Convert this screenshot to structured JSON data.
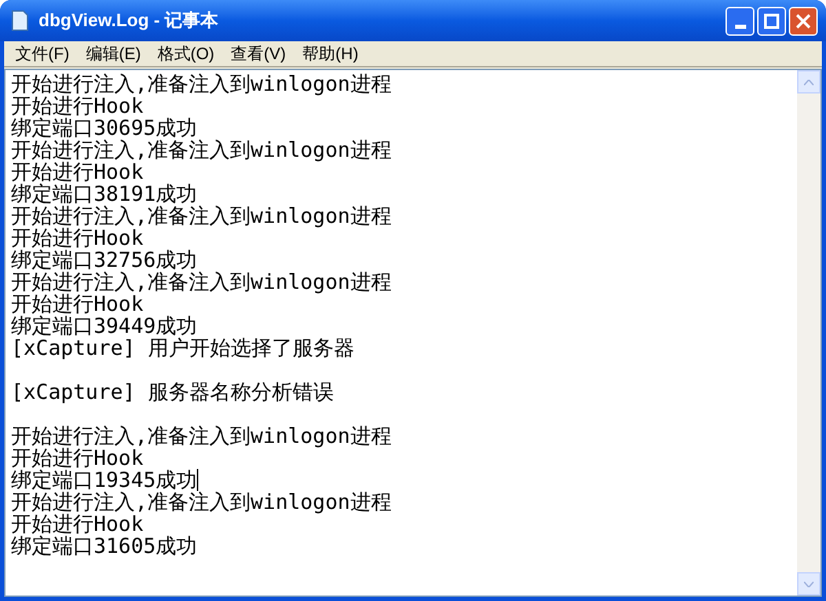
{
  "window": {
    "title": "dbgView.Log - 记事本"
  },
  "menu": [
    "文件(F)",
    "编辑(E)",
    "格式(O)",
    "查看(V)",
    "帮助(H)"
  ],
  "paragraphs": [
    {
      "lines": [
        {
          "text": "开始进行注入,准备注入到winlogon进程",
          "caret": false
        },
        {
          "text": "开始进行Hook",
          "caret": false
        },
        {
          "text": "绑定端口30695成功",
          "caret": false
        },
        {
          "text": "开始进行注入,准备注入到winlogon进程",
          "caret": false
        },
        {
          "text": "开始进行Hook",
          "caret": false
        },
        {
          "text": "绑定端口38191成功",
          "caret": false
        },
        {
          "text": "开始进行注入,准备注入到winlogon进程",
          "caret": false
        },
        {
          "text": "开始进行Hook",
          "caret": false
        },
        {
          "text": "绑定端口32756成功",
          "caret": false
        },
        {
          "text": "开始进行注入,准备注入到winlogon进程",
          "caret": false
        },
        {
          "text": "开始进行Hook",
          "caret": false
        },
        {
          "text": "绑定端口39449成功",
          "caret": false
        },
        {
          "text": "[xCapture] 用户开始选择了服务器",
          "caret": false
        }
      ]
    },
    {
      "lines": [
        {
          "text": "[xCapture] 服务器名称分析错误",
          "caret": false
        }
      ]
    },
    {
      "lines": [
        {
          "text": "开始进行注入,准备注入到winlogon进程",
          "caret": false
        },
        {
          "text": "开始进行Hook",
          "caret": false
        },
        {
          "text": "绑定端口19345成功",
          "caret": true
        },
        {
          "text": "开始进行注入,准备注入到winlogon进程",
          "caret": false
        },
        {
          "text": "开始进行Hook",
          "caret": false
        },
        {
          "text": "绑定端口31605成功",
          "caret": false
        }
      ]
    }
  ]
}
